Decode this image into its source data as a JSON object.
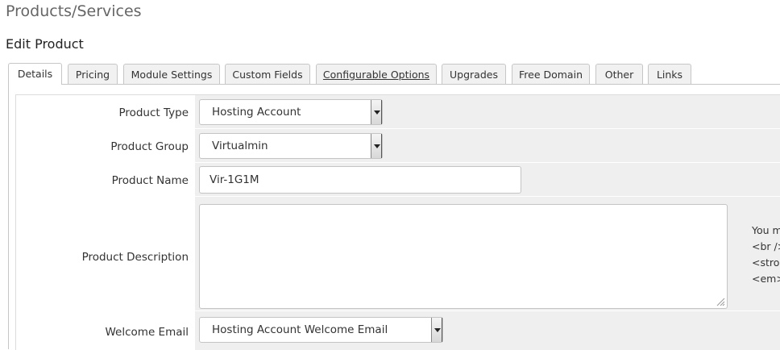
{
  "page": {
    "title": "Products/Services",
    "section": "Edit Product"
  },
  "tabs": [
    {
      "label": "Details",
      "active": true
    },
    {
      "label": "Pricing"
    },
    {
      "label": "Module Settings"
    },
    {
      "label": "Custom Fields"
    },
    {
      "label": "Configurable Options",
      "underline": true
    },
    {
      "label": "Upgrades"
    },
    {
      "label": "Free Domain"
    },
    {
      "label": "Other"
    },
    {
      "label": "Links"
    }
  ],
  "form": {
    "product_type": {
      "label": "Product Type",
      "value": "Hosting Account"
    },
    "product_group": {
      "label": "Product Group",
      "value": "Virtualmin"
    },
    "product_name": {
      "label": "Product Name",
      "value": "Vir-1G1M"
    },
    "product_description": {
      "label": "Product Description",
      "value": ""
    },
    "welcome_email": {
      "label": "Welcome Email",
      "value": "Hosting Account Welcome Email"
    }
  },
  "hint_lines": [
    "You m",
    "<br />",
    "<stron",
    "<em>"
  ]
}
